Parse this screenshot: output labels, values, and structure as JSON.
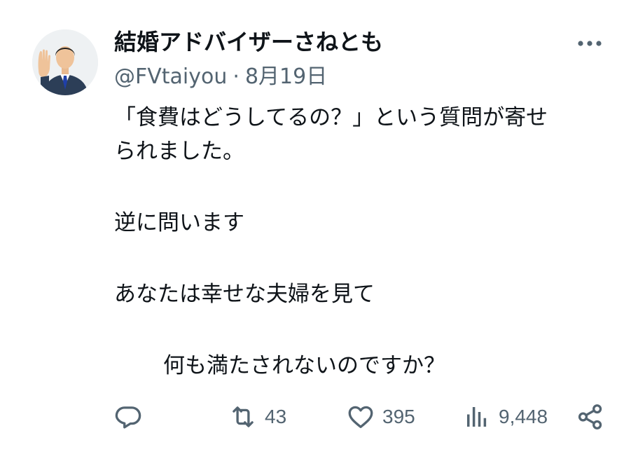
{
  "author": {
    "display_name": "結婚アドバイザーさねとも",
    "handle": "@FVtaiyou",
    "separator": "·",
    "date": "8月19日",
    "avatar_icon": "person-raising-hand-avatar-icon"
  },
  "tweet": {
    "lines": [
      "「食費はどうしてるの？」という質問が寄せ",
      "られました。",
      "逆に問います",
      "あなたは幸せな夫婦を見て",
      "何も満たされないのですか？"
    ]
  },
  "actions": {
    "reply": {
      "icon": "reply-icon",
      "count": ""
    },
    "retweet": {
      "icon": "retweet-icon",
      "count": "43"
    },
    "like": {
      "icon": "heart-icon",
      "count": "395"
    },
    "views": {
      "icon": "views-bar-chart-icon",
      "count": "9,448"
    },
    "share": {
      "icon": "share-icon"
    }
  },
  "more": {
    "icon": "more-dots-icon"
  },
  "colors": {
    "text_primary": "#0f1419",
    "text_secondary": "#536471",
    "background": "#ffffff"
  }
}
